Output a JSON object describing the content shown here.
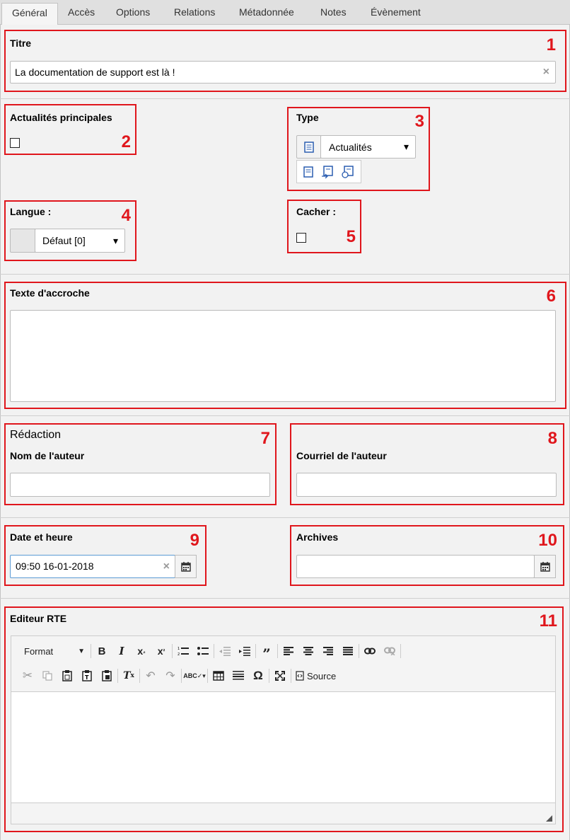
{
  "tabs": [
    "Général",
    "Accès",
    "Options",
    "Relations",
    "Métadonnée",
    "Notes",
    "Évènement"
  ],
  "annotations": [
    "1",
    "2",
    "3",
    "4",
    "5",
    "6",
    "7",
    "8",
    "9",
    "10",
    "11"
  ],
  "fields": {
    "titre": {
      "label": "Titre",
      "value": "La documentation de support est là !"
    },
    "actualites_principales": {
      "label": "Actualités principales",
      "checked": false
    },
    "type": {
      "label": "Type",
      "selected": "Actualités"
    },
    "langue": {
      "label": "Langue :",
      "selected": "Défaut [0]"
    },
    "cacher": {
      "label": "Cacher :",
      "checked": false
    },
    "texte_accroche": {
      "label": "Texte d'accroche",
      "value": ""
    },
    "redaction": {
      "heading": "Rédaction",
      "nom_label": "Nom de l'auteur",
      "nom_value": ""
    },
    "courriel": {
      "label": "Courriel de l'auteur",
      "value": ""
    },
    "date_heure": {
      "label": "Date et heure",
      "value": "09:50 16-01-2018"
    },
    "archives": {
      "label": "Archives",
      "value": ""
    },
    "rte": {
      "label": "Editeur RTE",
      "format_label": "Format",
      "source_label": "Source"
    }
  },
  "icons": {
    "clear": "×",
    "chevron": "▾",
    "calendar": "calendar-icon"
  },
  "colors": {
    "annotation": "#e0161c",
    "tab_bg": "#e0e0e0",
    "panel_bg": "#f2f2f2"
  }
}
